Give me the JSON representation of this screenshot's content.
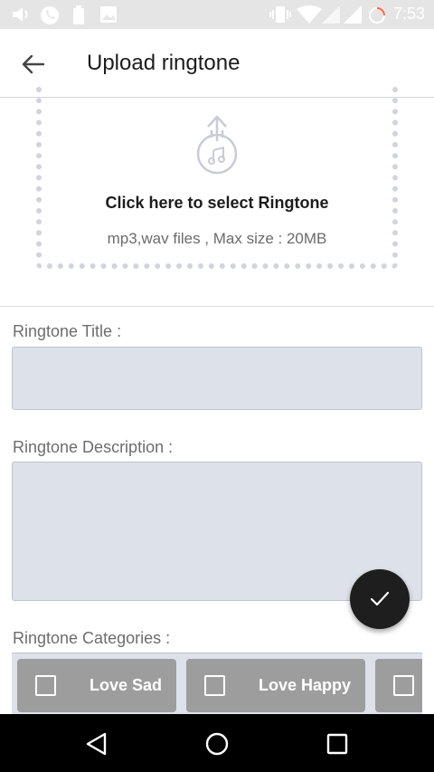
{
  "status_bar": {
    "time": "7:53"
  },
  "app_bar": {
    "title": "Upload ringtone"
  },
  "upload": {
    "title": "Click here to select Ringtone",
    "subtitle": "mp3,wav files , Max size : 20MB"
  },
  "form": {
    "title_label": "Ringtone Title :",
    "title_value": "",
    "description_label": "Ringtone Description :",
    "description_value": "",
    "categories_label": "Ringtone Categories :",
    "categories": [
      {
        "label": "Love Sad",
        "checked": false
      },
      {
        "label": "Love Happy",
        "checked": false
      },
      {
        "label": "",
        "checked": false
      }
    ]
  },
  "colors": {
    "field_bg": "#dde1ea",
    "chip_bg": "#9d9d9d",
    "fab_bg": "#1e1e1e"
  }
}
